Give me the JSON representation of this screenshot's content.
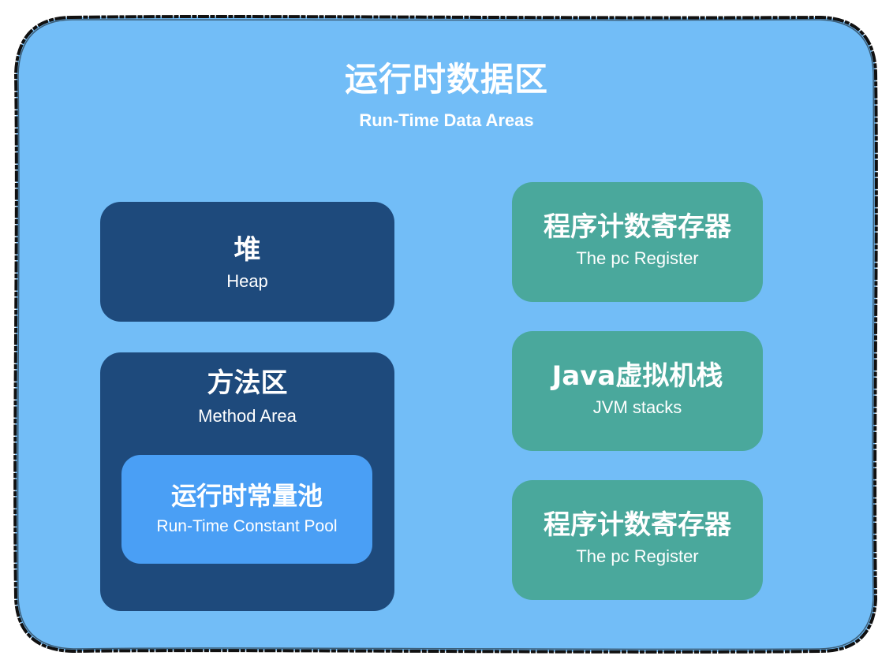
{
  "diagram": {
    "colors": {
      "outer_fill": "#72bdf7",
      "outer_stroke": "#111111",
      "dark_box": "#1e4a7c",
      "pool_box": "#4a9ff5",
      "green_box": "#4aa89c",
      "text": "#ffffff"
    },
    "runtime_data_areas": {
      "title_zh": "运行时数据区",
      "title_en": "Run-Time Data Areas"
    },
    "heap": {
      "title_zh": "堆",
      "title_en": "Heap"
    },
    "method_area": {
      "title_zh": "方法区",
      "title_en": "Method Area",
      "runtime_constant_pool": {
        "title_zh": "运行时常量池",
        "title_en": "Run-Time Constant Pool"
      }
    },
    "pc_register_1": {
      "title_zh": "程序计数寄存器",
      "title_en": "The pc Register"
    },
    "jvm_stacks": {
      "title_zh": "Java虚拟机栈",
      "title_en": "JVM stacks"
    },
    "pc_register_2": {
      "title_zh": "程序计数寄存器",
      "title_en": "The pc Register"
    }
  }
}
